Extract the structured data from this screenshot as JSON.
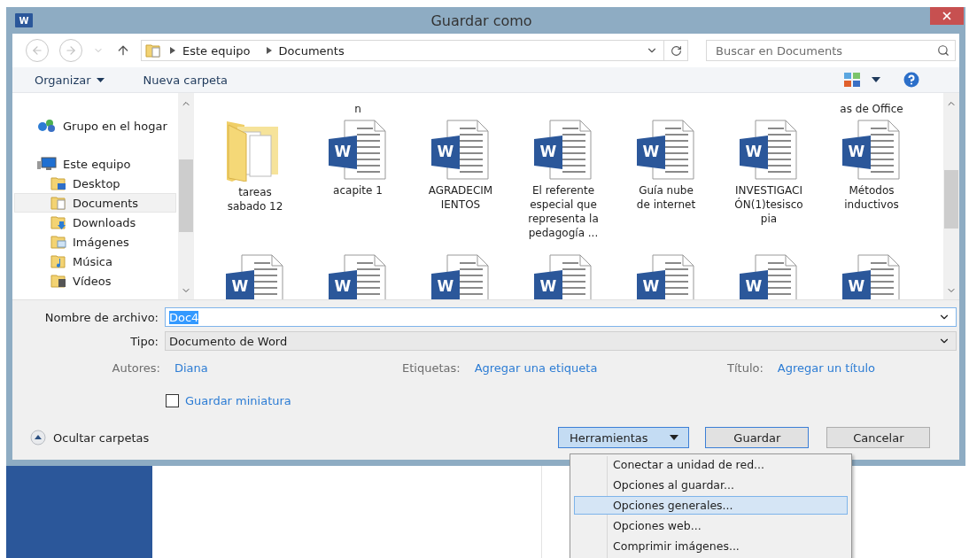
{
  "window": {
    "title": "Guardar como",
    "app_badge": "W"
  },
  "nav": {
    "breadcrumb": [
      "Este equipo",
      "Documents"
    ],
    "search": {
      "placeholder": "Buscar en Documents"
    }
  },
  "toolbar": {
    "organize": "Organizar",
    "new_folder": "Nueva carpeta"
  },
  "sidebar": {
    "items": [
      {
        "label": "Grupo en el hogar",
        "kind": "homegroup",
        "selected": false
      },
      {
        "label": "Este equipo",
        "kind": "computer",
        "selected": false,
        "children": [
          {
            "label": "Desktop",
            "kind": "desktop",
            "selected": false
          },
          {
            "label": "Documents",
            "kind": "documents",
            "selected": true
          },
          {
            "label": "Downloads",
            "kind": "downloads",
            "selected": false
          },
          {
            "label": "Imágenes",
            "kind": "pictures",
            "selected": false
          },
          {
            "label": "Música",
            "kind": "music",
            "selected": false
          },
          {
            "label": "Vídeos",
            "kind": "videos",
            "selected": false
          }
        ]
      }
    ]
  },
  "files": {
    "cut_row": [
      {
        "kind": "hidden"
      },
      {
        "kind": "label",
        "label": "n"
      },
      {
        "kind": "hidden"
      },
      {
        "kind": "hidden"
      },
      {
        "kind": "hidden"
      },
      {
        "kind": "hidden"
      },
      {
        "kind": "label",
        "label": "as de Office"
      }
    ],
    "rows": [
      [
        {
          "kind": "folder",
          "label": "tareas\nsabado 12"
        },
        {
          "kind": "word",
          "badge": "W",
          "label": "acapite 1"
        },
        {
          "kind": "word",
          "badge": "W",
          "label": "AGRADECIM\nIENTOS"
        },
        {
          "kind": "word",
          "badge": "W",
          "label": "El referente\nespecial que\nrepresenta la\npedagogía ..."
        },
        {
          "kind": "word",
          "badge": "W",
          "label": "Guía nube\nde internet"
        },
        {
          "kind": "word",
          "badge": "W",
          "label": "INVESTIGACI\nÓN(1)tesisco\npia"
        },
        {
          "kind": "word",
          "badge": "W",
          "label": "Métodos\ninductivos"
        }
      ],
      [
        {
          "kind": "word",
          "badge": "W"
        },
        {
          "kind": "word",
          "badge": "W"
        },
        {
          "kind": "word",
          "badge": "W"
        },
        {
          "kind": "word",
          "badge": "W"
        },
        {
          "kind": "word",
          "badge": "W"
        },
        {
          "kind": "word",
          "badge": "W"
        },
        {
          "kind": "word",
          "badge": "W"
        }
      ]
    ]
  },
  "form": {
    "filename": {
      "label": "Nombre de archivo:",
      "value": "Doc4",
      "highlighted": true
    },
    "type": {
      "label": "Tipo:",
      "value": "Documento de Word"
    },
    "metadata": [
      {
        "label": "Autores:",
        "value": "Diana"
      },
      {
        "label": "Etiquetas:",
        "value": "Agregar una etiqueta"
      },
      {
        "label": "Título:",
        "value": "Agregar un título"
      }
    ],
    "thumbnail": {
      "label": "Guardar miniatura",
      "checked": false
    }
  },
  "footer": {
    "hide_folders": "Ocultar carpetas",
    "tools": {
      "label": "Herramientas",
      "expanded": true
    },
    "save": {
      "label": "Guardar",
      "default": true
    },
    "cancel": "Cancelar"
  },
  "tools_menu": [
    {
      "label": "Conectar a unidad de red...",
      "selected": false
    },
    {
      "label": "Opciones al guardar...",
      "selected": false
    },
    {
      "label": "Opciones generales...",
      "selected": true
    },
    {
      "label": "Opciones web...",
      "selected": false
    },
    {
      "label": "Comprimir imágenes...",
      "selected": false
    }
  ]
}
